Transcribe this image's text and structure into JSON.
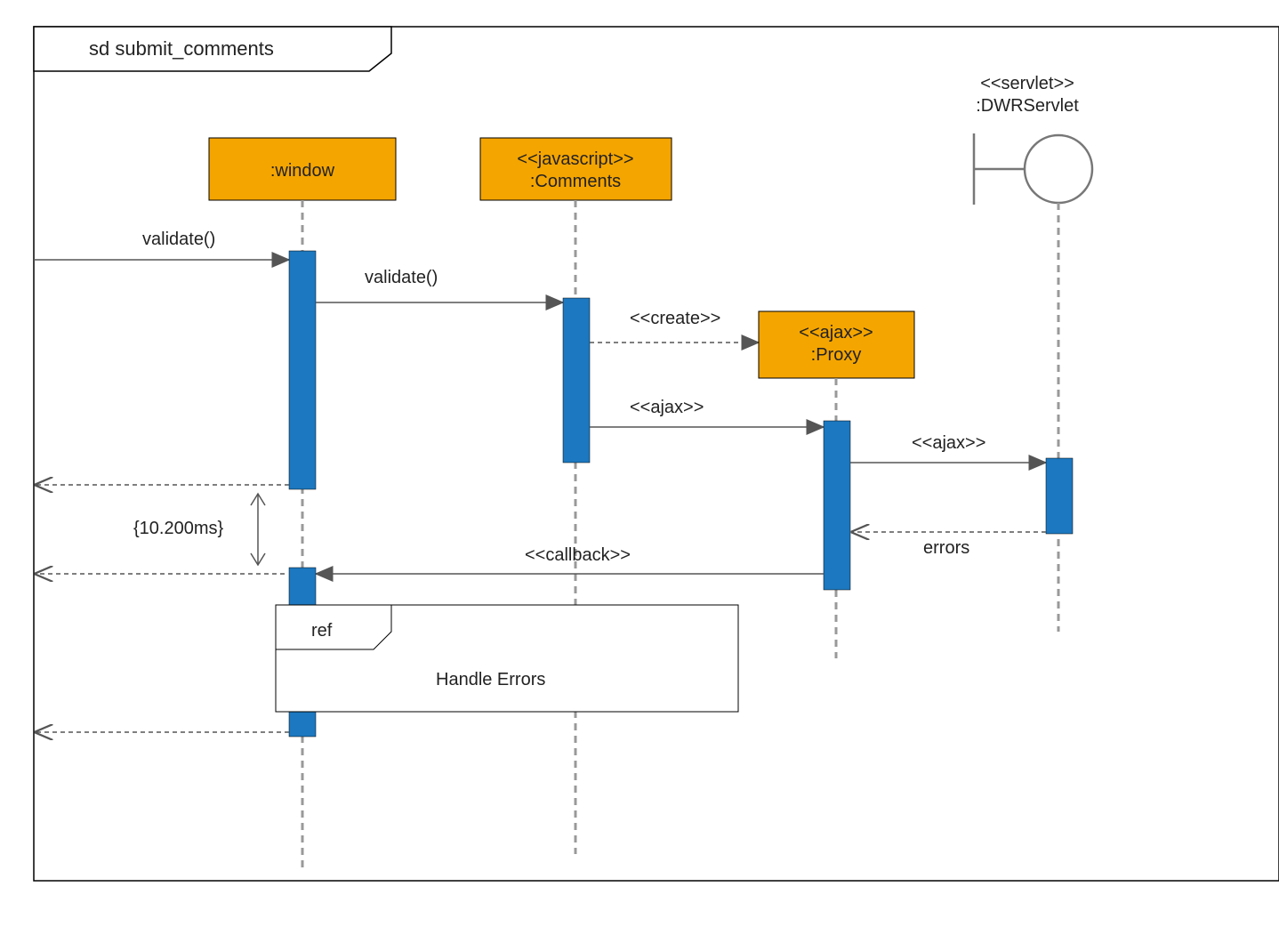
{
  "frame": {
    "title": "sd submit_comments"
  },
  "participants": {
    "window": {
      "label": ":window"
    },
    "comments": {
      "stereotype": "<<javascript>>",
      "label": ":Comments"
    },
    "proxy": {
      "stereotype": "<<ajax>>",
      "label": ":Proxy"
    },
    "servlet": {
      "stereotype": "<<servlet>>",
      "label": ":DWRServlet"
    }
  },
  "messages": {
    "validate1": "validate()",
    "validate2": "validate()",
    "create": "<<create>>",
    "ajax1": "<<ajax>>",
    "ajax2": "<<ajax>>",
    "errors": "errors",
    "callback": "<<callback>>"
  },
  "duration": "{10.200ms}",
  "ref": {
    "tag": "ref",
    "label": "Handle Errors"
  }
}
